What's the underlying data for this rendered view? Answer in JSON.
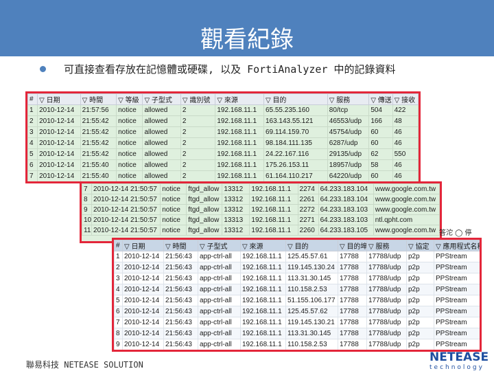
{
  "slide": {
    "title": "觀看紀錄",
    "bullet": "可直接查看存放在記憶體或硬碟, 以及 FortiAnalyzer 中的記錄資料",
    "footer": "聯易科技 NETEASE SOLUTION",
    "logo_main": "NETEASE",
    "logo_sub": "technology",
    "corner_text": "答沱 ◯ 停"
  },
  "panel1": {
    "headers": [
      "#",
      "▽ 日期",
      "▽ 時間",
      "▽ 等級",
      "▽ 子型式",
      "▽ 識別號",
      "▽ 來源",
      "▽ 目的",
      "▽ 服務",
      "▽ 傳送",
      "▽ 接收"
    ],
    "rows": [
      [
        "1",
        "2010-12-14",
        "21:57:56",
        "notice",
        "allowed",
        "2",
        "192.168.11.1",
        "65.55.235.160",
        "80/tcp",
        "504",
        "422"
      ],
      [
        "2",
        "2010-12-14",
        "21:55:42",
        "notice",
        "allowed",
        "2",
        "192.168.11.1",
        "163.143.55.121",
        "46553/udp",
        "166",
        "48"
      ],
      [
        "3",
        "2010-12-14",
        "21:55:42",
        "notice",
        "allowed",
        "2",
        "192.168.11.1",
        "69.114.159.70",
        "45754/udp",
        "60",
        "46"
      ],
      [
        "4",
        "2010-12-14",
        "21:55:42",
        "notice",
        "allowed",
        "2",
        "192.168.11.1",
        "98.184.111.135",
        "6287/udp",
        "60",
        "46"
      ],
      [
        "5",
        "2010-12-14",
        "21:55:42",
        "notice",
        "allowed",
        "2",
        "192.168.11.1",
        "24.22.167.116",
        "29135/udp",
        "62",
        "550"
      ],
      [
        "6",
        "2010-12-14",
        "21:55:40",
        "notice",
        "allowed",
        "2",
        "192.168.11.1",
        "175.26.153.11",
        "18957/udp",
        "58",
        "46"
      ],
      [
        "7",
        "2010-12-14",
        "21:55:40",
        "notice",
        "allowed",
        "2",
        "192.168.11.1",
        "61.164.110.217",
        "64220/udp",
        "60",
        "46"
      ]
    ]
  },
  "panel2": {
    "rows": [
      [
        "7",
        "2010-12-14 21:50:57",
        "notice",
        "ftgd_allow",
        "13312",
        "192.168.11.1",
        "2274",
        "64.233.183.104",
        "www.google.com.tw"
      ],
      [
        "8",
        "2010-12-14 21:50:57",
        "notice",
        "ftgd_allow",
        "13312",
        "192.168.11.1",
        "2261",
        "64.233.183.104",
        "www.google.com.tw"
      ],
      [
        "9",
        "2010-12-14 21:50:57",
        "notice",
        "ftgd_allow",
        "13312",
        "192.168.11.1",
        "2272",
        "64.233.183.103",
        "www.google.com.tw"
      ],
      [
        "10",
        "2010-12-14 21:50:57",
        "notice",
        "ftgd_allow",
        "13313",
        "192.168.11.1",
        "2271",
        "64.233.183.103",
        "ntl.qpht.com"
      ],
      [
        "11",
        "2010-12-14 21:50:57",
        "notice",
        "ftgd_allow",
        "13312",
        "192.168.11.1",
        "2260",
        "64.233.183.105",
        "www.google.com.tw"
      ]
    ]
  },
  "panel3": {
    "headers": [
      "#",
      "▽ 日期",
      "▽ 時間",
      "▽ 子型式",
      "▽ 來源",
      "▽ 目的",
      "▽ 目的埠",
      "▽ 服務",
      "▽ 協定",
      "▽ 應用程式名稱"
    ],
    "rows": [
      [
        "1",
        "2010-12-14",
        "21:56:43",
        "app-ctrl-all",
        "192.168.11.1",
        "125.45.57.61",
        "17788",
        "17788/udp",
        "p2p",
        "PPStream"
      ],
      [
        "2",
        "2010-12-14",
        "21:56:43",
        "app-ctrl-all",
        "192.168.11.1",
        "119.145.130.24",
        "17788",
        "17788/udp",
        "p2p",
        "PPStream"
      ],
      [
        "3",
        "2010-12-14",
        "21:56:43",
        "app-ctrl-all",
        "192.168.11.1",
        "113.31.30.145",
        "17788",
        "17788/udp",
        "p2p",
        "PPStream"
      ],
      [
        "4",
        "2010-12-14",
        "21:56:43",
        "app-ctrl-all",
        "192.168.11.1",
        "110.158.2.53",
        "17788",
        "17788/udp",
        "p2p",
        "PPStream"
      ],
      [
        "5",
        "2010-12-14",
        "21:56:43",
        "app-ctrl-all",
        "192.168.11.1",
        "51.155.106.177",
        "17788",
        "17788/udp",
        "p2p",
        "PPStream"
      ],
      [
        "6",
        "2010-12-14",
        "21:56:43",
        "app-ctrl-all",
        "192.168.11.1",
        "125.45.57.62",
        "17788",
        "17788/udp",
        "p2p",
        "PPStream"
      ],
      [
        "7",
        "2010-12-14",
        "21:56:43",
        "app-ctrl-all",
        "192.168.11.1",
        "119.145.130.21",
        "17788",
        "17788/udp",
        "p2p",
        "PPStream"
      ],
      [
        "8",
        "2010-12-14",
        "21:56:43",
        "app-ctrl-all",
        "192.168.11.1",
        "113.31.30.145",
        "17788",
        "17788/udp",
        "p2p",
        "PPStream"
      ],
      [
        "9",
        "2010-12-14",
        "21:56:43",
        "app-ctrl-all",
        "192.168.11.1",
        "110.158.2.53",
        "17788",
        "17788/udp",
        "p2p",
        "PPStream"
      ]
    ]
  }
}
